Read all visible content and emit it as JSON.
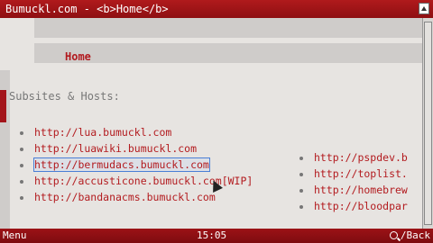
{
  "window": {
    "title": "Bumuckl.com - <b>Home</b>"
  },
  "nav": {
    "home": "Home"
  },
  "main": {
    "section_title": "Subsites & Hosts:",
    "hosts": [
      "http://lua.bumuckl.com",
      "http://luawiki.bumuckl.com",
      "http://bermudacs.bumuckl.com",
      "http://accusticone.bumuckl.com[WIP]",
      "http://bandanacms.bumuckl.com"
    ],
    "selected_index": 2
  },
  "right_links": [
    "http://pspdev.b",
    "http://toplist.",
    "http://homebrew",
    "http://bloodpar"
  ],
  "softkeys": {
    "left": "Menu",
    "clock": "15:05",
    "right": "/Back"
  }
}
